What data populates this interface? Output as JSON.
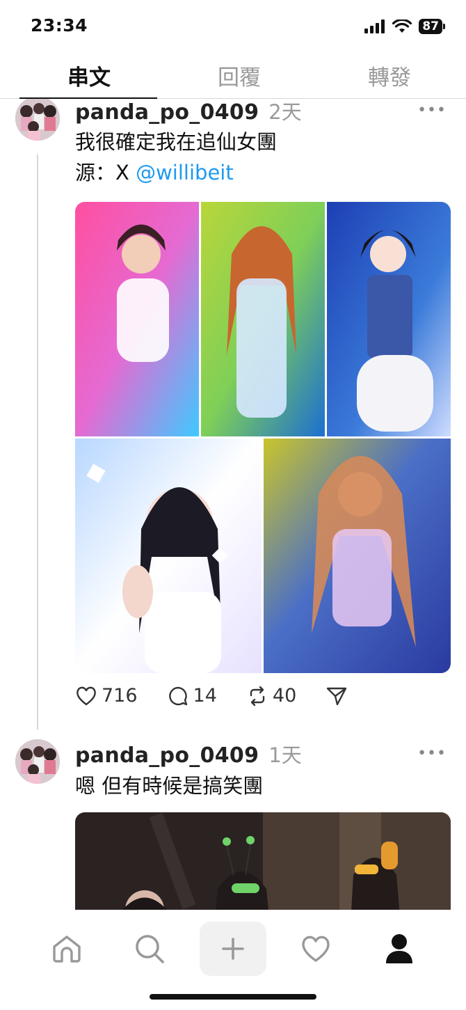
{
  "status_bar": {
    "time": "23:34",
    "battery": "87"
  },
  "tabs": [
    {
      "label": "串文",
      "active": true
    },
    {
      "label": "回覆",
      "active": false
    },
    {
      "label": "轉發",
      "active": false
    }
  ],
  "posts": [
    {
      "username": "panda_po_0409",
      "time_ago": "2天",
      "text_line1": "我很確定我在追仙女團",
      "source_prefix": "源：X ",
      "mention": "@willibeit",
      "likes": "716",
      "comments": "14",
      "reposts": "40"
    },
    {
      "username": "panda_po_0409",
      "time_ago": "1天",
      "text_line1": "嗯 但有時候是搞笑團"
    }
  ],
  "more_label": "•••",
  "nav": [
    "home-icon",
    "search-icon",
    "plus-icon",
    "heart-icon",
    "profile-icon"
  ]
}
